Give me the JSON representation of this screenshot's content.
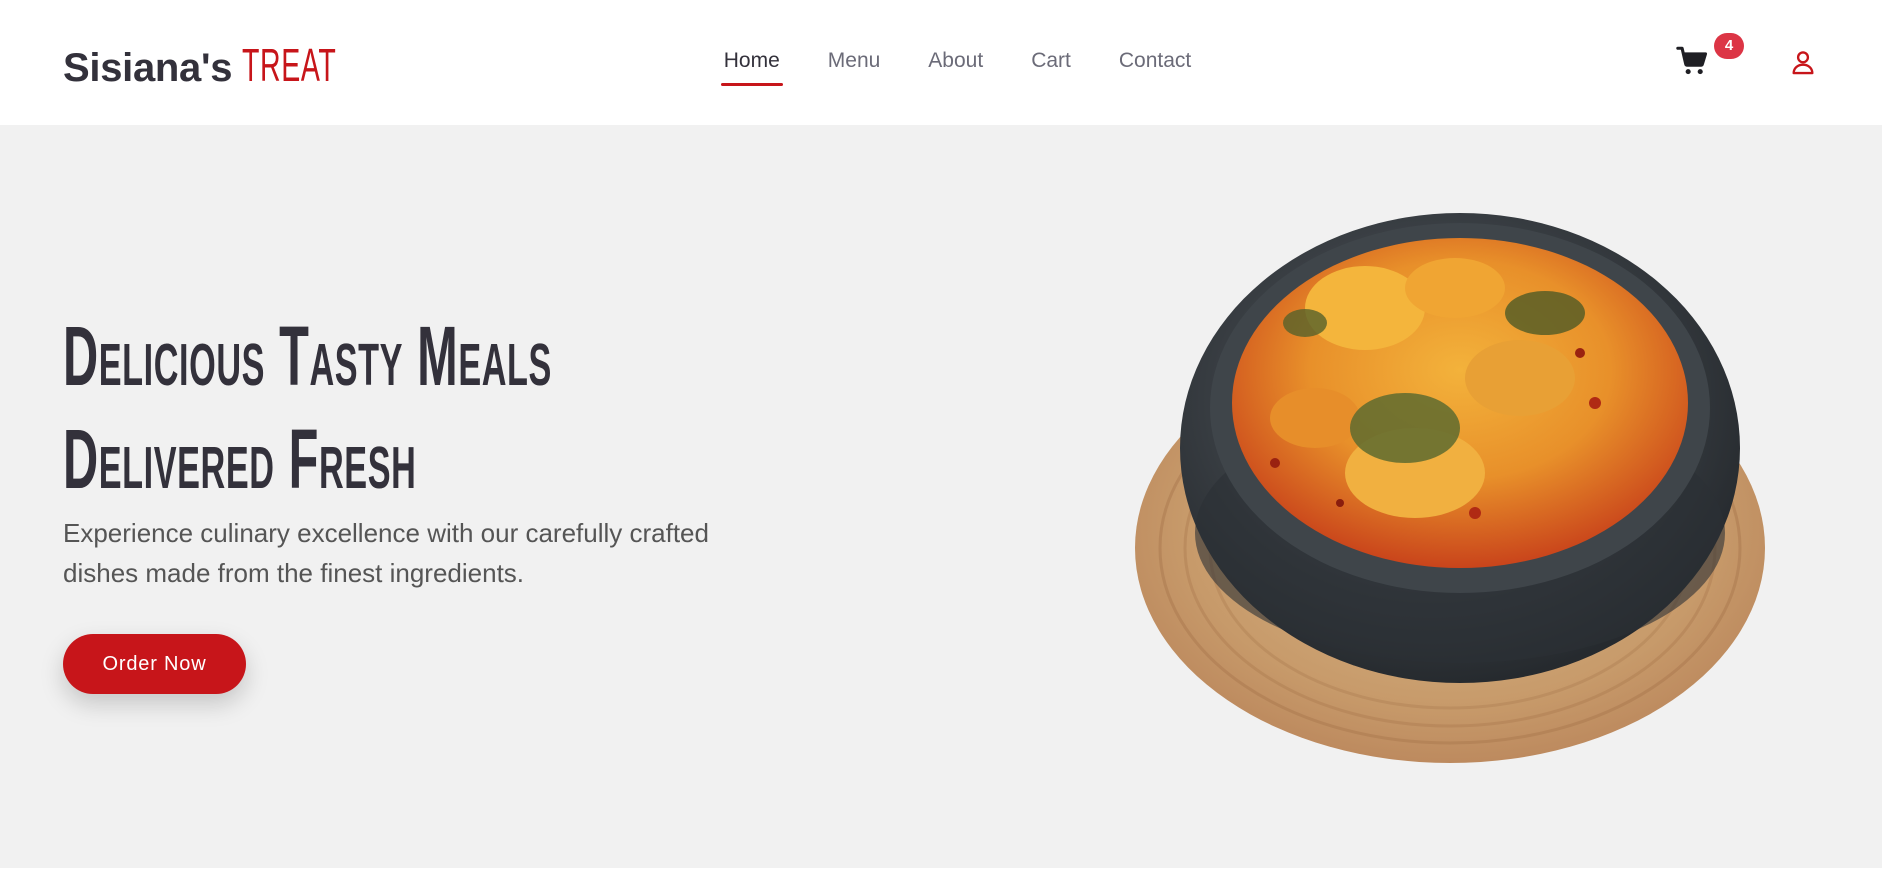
{
  "brand": {
    "name": "Sisiana's",
    "accent": "Treat"
  },
  "nav": {
    "items": [
      {
        "label": "Home",
        "active": true
      },
      {
        "label": "Menu",
        "active": false
      },
      {
        "label": "About",
        "active": false
      },
      {
        "label": "Cart",
        "active": false
      },
      {
        "label": "Contact",
        "active": false
      }
    ]
  },
  "header": {
    "cart_icon": "shopping-cart-icon",
    "cart_count": "4",
    "user_icon": "user-icon"
  },
  "hero": {
    "title_line1": "Delicious Tasty Meals",
    "title_line2": "Delivered Fresh",
    "subtitle": "Experience culinary excellence with our carefully crafted dishes made from the finest ingredients.",
    "cta_label": "Order Now",
    "image_subject": "bowl of soup with fish in a clay pot on a woven mat"
  },
  "colors": {
    "accent": "#c7151a",
    "badge": "#dc3545",
    "text_dark": "#33313b",
    "nav_text": "#6b6b78",
    "hero_bg": "#f1f1f1"
  }
}
